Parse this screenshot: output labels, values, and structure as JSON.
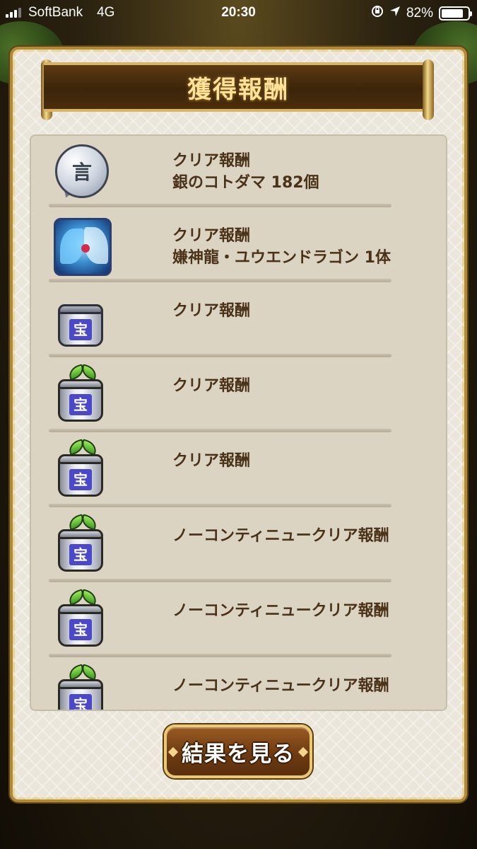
{
  "status_bar": {
    "carrier": "SoftBank",
    "network": "4G",
    "time": "20:30",
    "battery": "82%",
    "battery_level": 0.82
  },
  "dialog": {
    "title": "獲得報酬",
    "rewards": [
      {
        "label": "クリア報酬",
        "detail": "銀のコトダマ 182個",
        "icon": "silver-kotodama-icon"
      },
      {
        "label": "クリア報酬",
        "detail": "嫌神龍・ユウエンドラゴン 1体",
        "icon": "dragon-monster-icon"
      },
      {
        "label": "クリア報酬",
        "detail": "",
        "icon": "treasure-box-silver-icon"
      },
      {
        "label": "クリア報酬",
        "detail": "",
        "icon": "treasure-box-green-icon"
      },
      {
        "label": "クリア報酬",
        "detail": "",
        "icon": "treasure-box-green-icon"
      },
      {
        "label": "ノーコンティニュークリア報酬",
        "detail": "",
        "icon": "treasure-box-green-icon"
      },
      {
        "label": "ノーコンティニュークリア報酬",
        "detail": "",
        "icon": "treasure-box-green-icon"
      },
      {
        "label": "ノーコンティニュークリア報酬",
        "detail": "",
        "icon": "treasure-box-green-icon"
      }
    ],
    "box_label": "宝",
    "kotodama_glyph": "言",
    "button_label": "結果を見る"
  }
}
